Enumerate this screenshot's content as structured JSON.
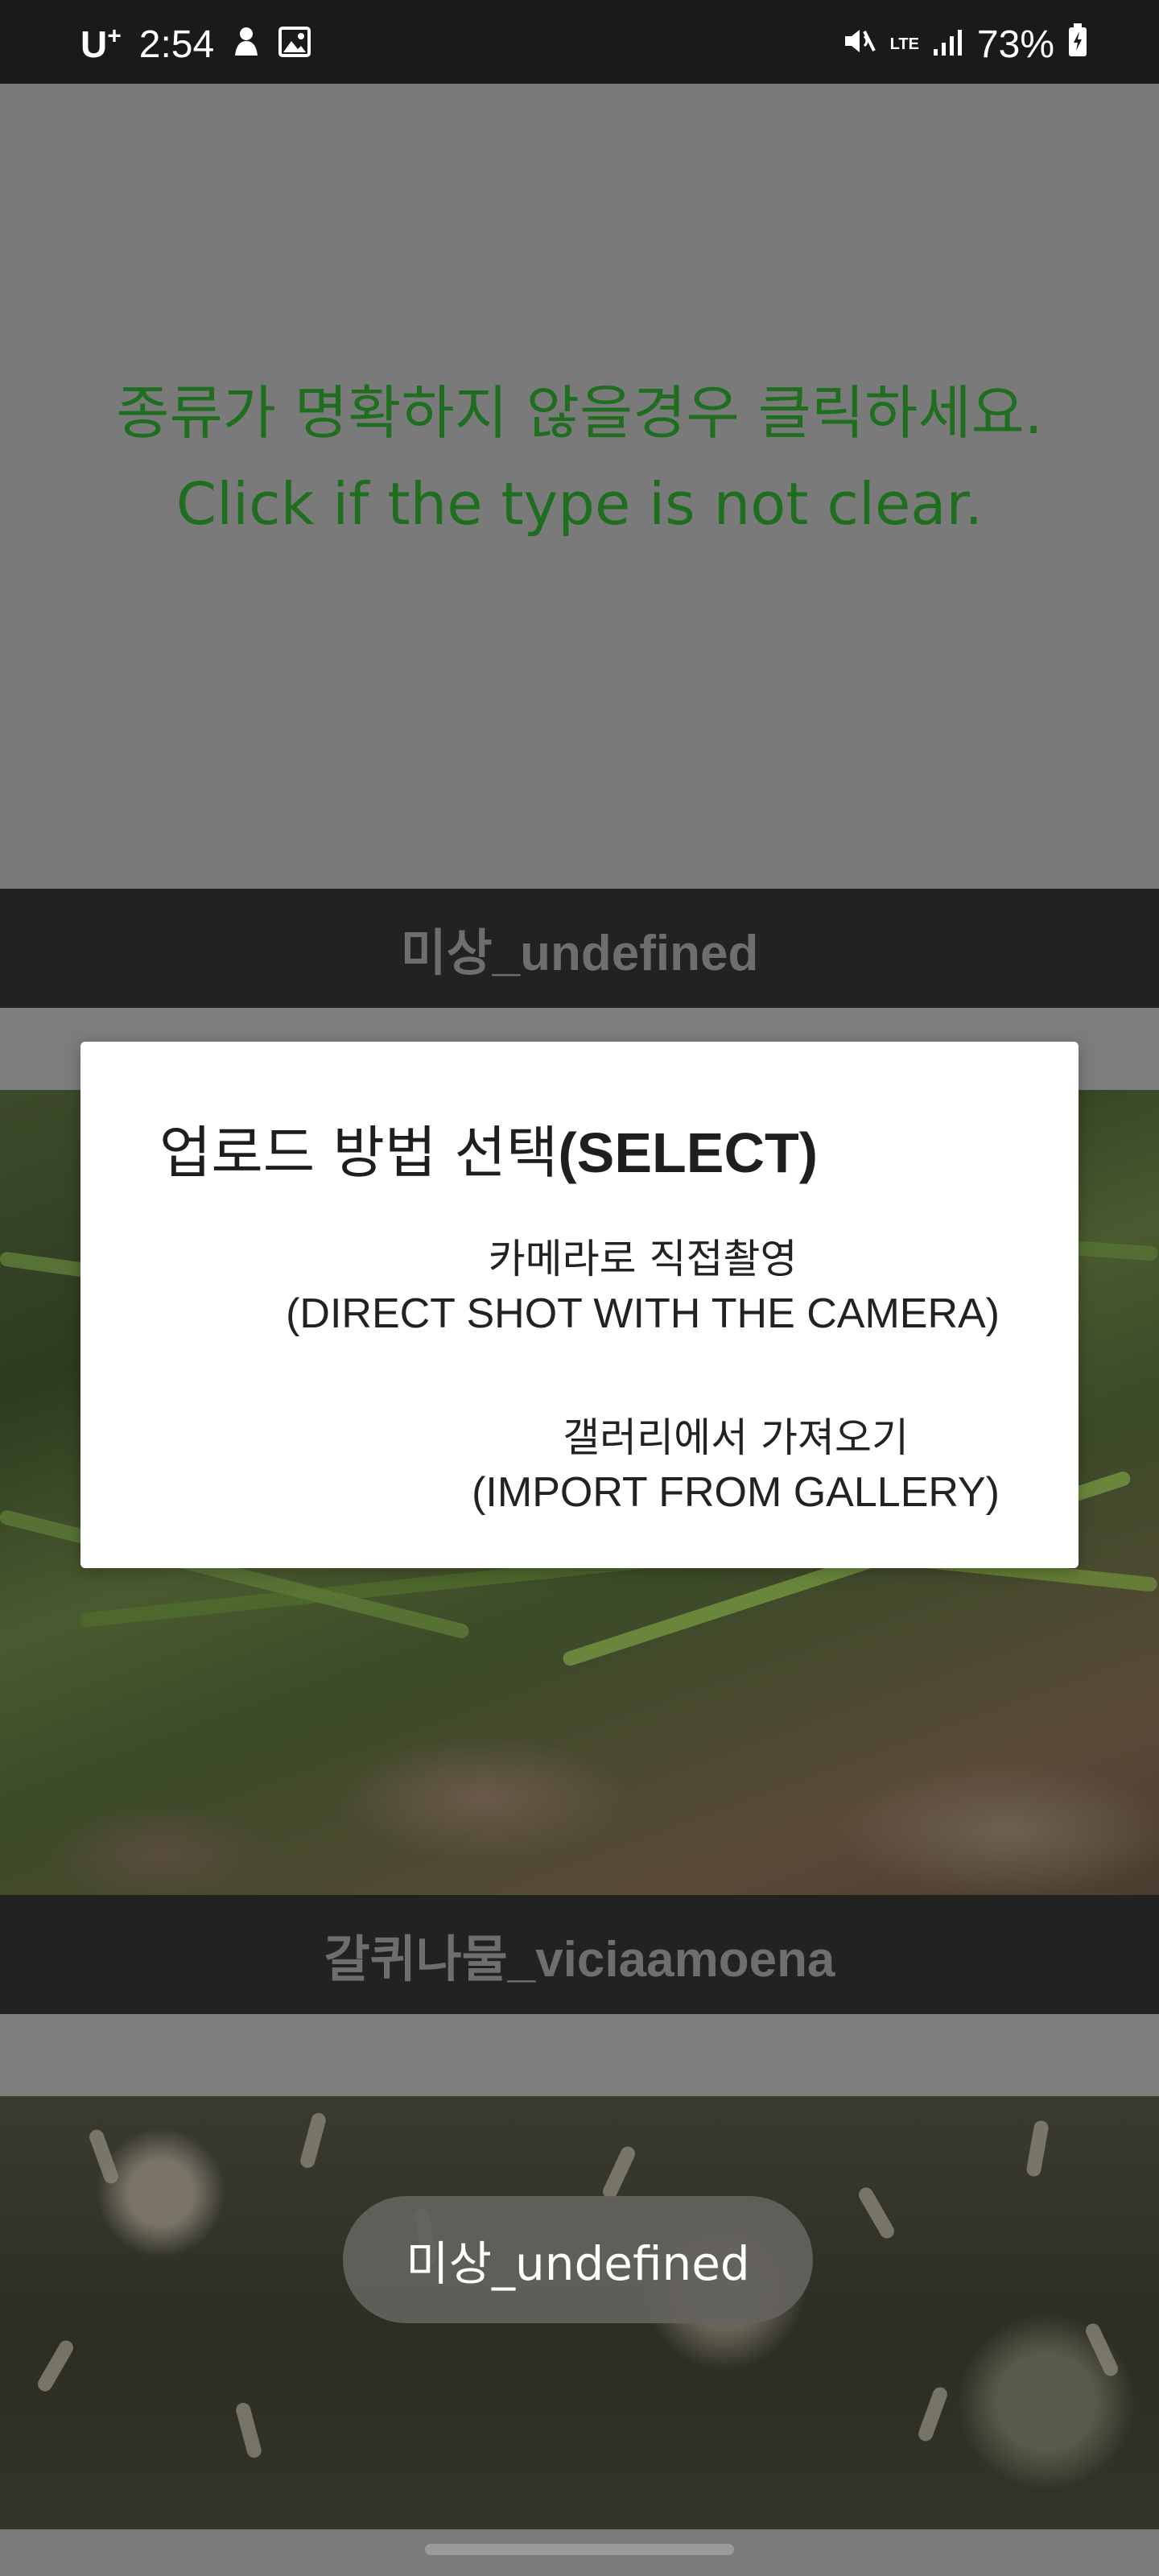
{
  "status_bar": {
    "carrier": "U",
    "carrier_sup": "+",
    "time": "2:54",
    "network": "LTE",
    "battery": "73%",
    "icons": [
      "user-icon",
      "image-icon",
      "mute-icon",
      "signal-icon",
      "battery-charging-icon"
    ]
  },
  "hint": {
    "korean": "종류가 명확하지 않을경우 클릭하세요.",
    "english": "Click if the type is not clear."
  },
  "cards": [
    {
      "label": "미상_undefined"
    },
    {
      "label": "갈퀴나물_viciaamoena"
    }
  ],
  "dialog": {
    "title_ko": "업로드 방법 선택",
    "title_en": "(SELECT)",
    "options": [
      {
        "ko": "카메라로 직접촬영",
        "en": "(DIRECT SHOT WITH THE CAMERA)"
      },
      {
        "ko": "갤러리에서 가져오기",
        "en": "(IMPORT FROM GALLERY)"
      }
    ]
  },
  "toast": {
    "text": "미상_undefined"
  },
  "colors": {
    "hint_text": "#1f6e1f",
    "label_bar": "#222222",
    "dialog_bg": "#ffffff"
  }
}
